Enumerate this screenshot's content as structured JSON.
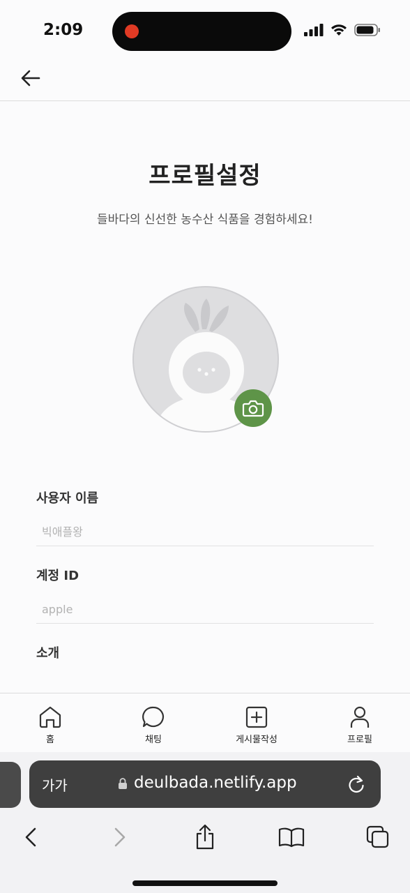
{
  "status_bar": {
    "time": "2:09"
  },
  "header": {
    "back_icon": "arrow-left-icon"
  },
  "page": {
    "title": "프로필설정",
    "subtitle": "들바다의 신선한 농수산 식품을 경험하세요!"
  },
  "avatar": {
    "camera_icon": "camera-icon",
    "accent_color": "#5e9448"
  },
  "form": {
    "username": {
      "label": "사용자 이름",
      "placeholder": "빅애플왕"
    },
    "account_id": {
      "label": "계정 ID",
      "placeholder": "apple"
    },
    "intro": {
      "label": "소개"
    }
  },
  "tab_bar": {
    "items": [
      {
        "label": "홈",
        "icon": "home-icon"
      },
      {
        "label": "채팅",
        "icon": "chat-icon"
      },
      {
        "label": "게시물작성",
        "icon": "add-post-icon"
      },
      {
        "label": "프로필",
        "icon": "user-icon"
      }
    ]
  },
  "browser": {
    "aa_label": "가가",
    "url": "deulbada.netlify.app"
  }
}
